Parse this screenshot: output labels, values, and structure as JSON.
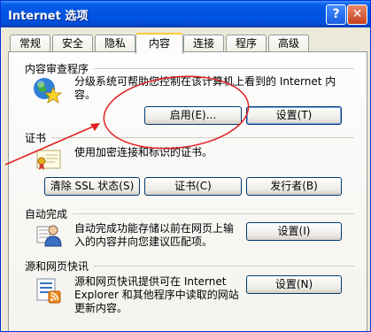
{
  "window": {
    "title": "Internet 选项",
    "help_label": "?",
    "close_label": "✕"
  },
  "tabs": [
    {
      "label": "常规"
    },
    {
      "label": "安全"
    },
    {
      "label": "隐私"
    },
    {
      "label": "内容",
      "active": true
    },
    {
      "label": "连接"
    },
    {
      "label": "程序"
    },
    {
      "label": "高级"
    }
  ],
  "content_advisor": {
    "title": "内容审查程序",
    "description_line1": "分级系统可帮助您控制在该计算机上看到的 Internet 内",
    "description_line2": "容。",
    "enable_button": "启用(E)...",
    "settings_button": "设置(T)",
    "icon": "globe-star-icon"
  },
  "certificates": {
    "title": "证书",
    "description": "使用加密连接和标识的证书。",
    "clear_ssl_button": "清除 SSL 状态(S)",
    "certificates_button": "证书(C)",
    "publishers_button": "发行者(B)",
    "icon": "certificate-icon"
  },
  "autocomplete": {
    "title": "自动完成",
    "description_line1": "自动完成功能存储以前在网页上输",
    "description_line2": "入的内容并向您建议匹配项。",
    "settings_button": "设置(I)",
    "icon": "autocomplete-user-icon"
  },
  "feeds": {
    "title": "源和网页快讯",
    "description_line1": "源和网页快讯提供可在 Internet",
    "description_line2": "Explorer 和其他程序中读取的网站",
    "description_line3": "更新内容。",
    "settings_button": "设置(N)",
    "icon": "feeds-list-icon"
  },
  "colors": {
    "annotation": "#e02020",
    "titlebar": "#0054e3",
    "tab_highlight": "#ffc83c"
  }
}
